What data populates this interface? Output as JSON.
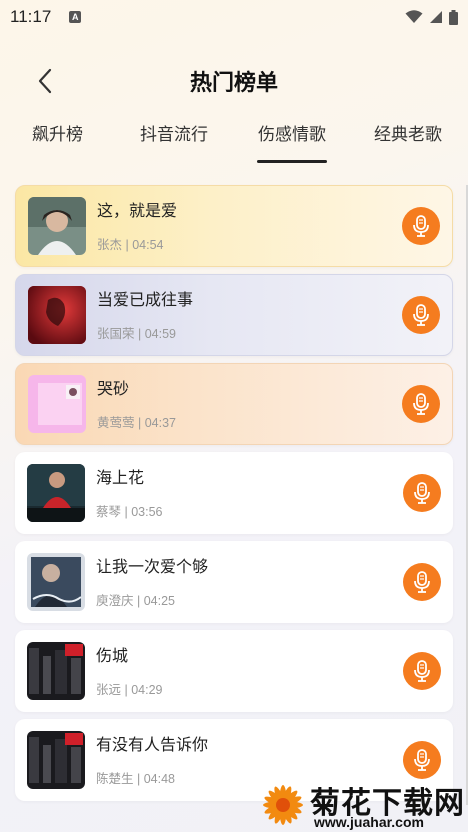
{
  "status_bar": {
    "time": "11:17",
    "notification_badge": "A"
  },
  "header": {
    "title": "热门榜单"
  },
  "tabs": [
    {
      "label": "飙升榜"
    },
    {
      "label": "抖音流行"
    },
    {
      "label": "伤感情歌",
      "active": true
    },
    {
      "label": "经典老歌"
    }
  ],
  "songs": [
    {
      "title": "这，就是爱",
      "meta": "张杰 | 04:54"
    },
    {
      "title": "当爱已成往事",
      "meta": "张国荣 | 04:59"
    },
    {
      "title": "哭砂",
      "meta": "黄莺莺 | 04:37"
    },
    {
      "title": "海上花",
      "meta": "蔡琴 | 03:56"
    },
    {
      "title": "让我一次爱个够",
      "meta": "庾澄庆 | 04:25"
    },
    {
      "title": "伤城",
      "meta": "张远 | 04:29"
    },
    {
      "title": "有没有人告诉你",
      "meta": "陈楚生 | 04:48"
    }
  ],
  "watermark": {
    "title": "菊花下载网",
    "url": "www.juahar.com"
  },
  "colors": {
    "accent": "#f57c1f",
    "active_tab_underline": "#222222"
  }
}
